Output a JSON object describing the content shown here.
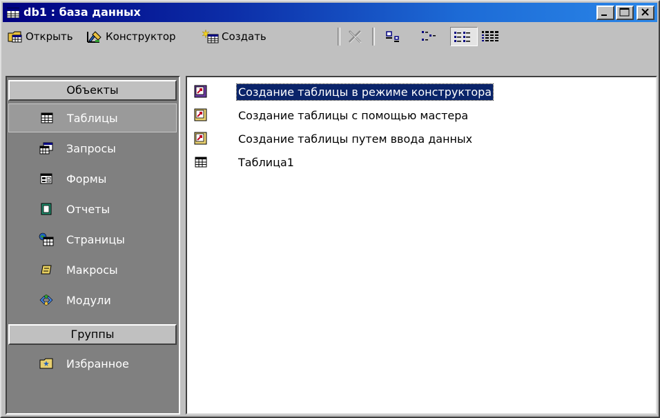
{
  "window": {
    "title": "db1 : база данных",
    "controls": [
      "minimize",
      "maximize",
      "close"
    ]
  },
  "toolbar": {
    "open_label": "Открыть",
    "design_label": "Конструктор",
    "create_label": "Создать",
    "tools": [
      "delete-icon",
      "large-icons-icon",
      "small-icons-icon",
      "list-view-icon",
      "details-view-icon"
    ]
  },
  "sidebar": {
    "objects_header": "Объекты",
    "groups_header": "Группы",
    "items": [
      {
        "label": "Таблицы",
        "icon": "table-icon"
      },
      {
        "label": "Запросы",
        "icon": "query-icon"
      },
      {
        "label": "Формы",
        "icon": "form-icon"
      },
      {
        "label": "Отчеты",
        "icon": "report-icon"
      },
      {
        "label": "Страницы",
        "icon": "page-icon"
      },
      {
        "label": "Макросы",
        "icon": "macro-icon"
      },
      {
        "label": "Модули",
        "icon": "module-icon"
      }
    ],
    "favorites": {
      "label": "Избранное",
      "icon": "favorites-folder-icon"
    }
  },
  "list": {
    "items": [
      {
        "label": "Создание таблицы в режиме конструктора",
        "icon": "shortcut-icon",
        "selected": true
      },
      {
        "label": "Создание таблицы с помощью мастера",
        "icon": "shortcut-icon",
        "selected": false
      },
      {
        "label": "Создание таблицы путем ввода данных",
        "icon": "shortcut-icon",
        "selected": false
      },
      {
        "label": "Таблица1",
        "icon": "table-icon",
        "selected": false
      }
    ]
  },
  "colors": {
    "title_start": "#000080",
    "title_end": "#2a86e8",
    "face": "#c0c0c0",
    "sidebar_bg": "#808080",
    "selection": "#0a246a"
  }
}
